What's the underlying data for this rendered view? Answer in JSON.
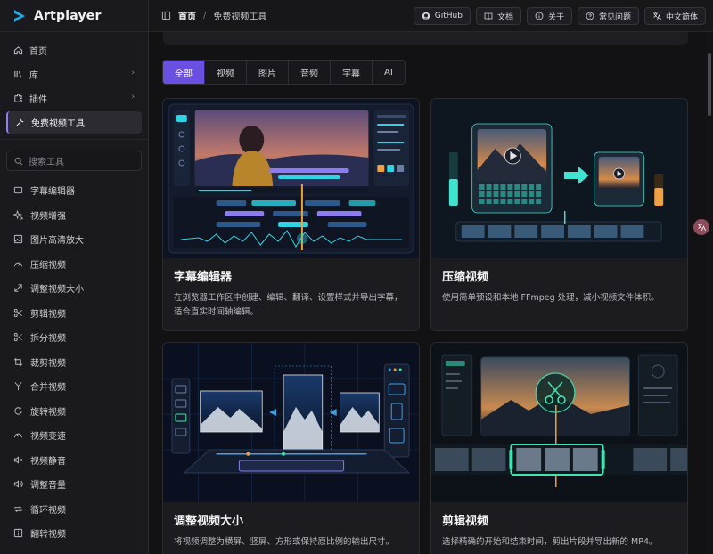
{
  "app": {
    "name": "Artplayer"
  },
  "sidebar": {
    "items": [
      {
        "label": "首页",
        "icon": "home-icon"
      },
      {
        "label": "库",
        "icon": "library-icon",
        "chevron": "›"
      },
      {
        "label": "插件",
        "icon": "puzzle-icon",
        "chevron": "›"
      },
      {
        "label": "免费视频工具",
        "icon": "wrench-icon"
      }
    ],
    "search_placeholder": "搜索工具",
    "tools": [
      {
        "label": "字幕编辑器",
        "icon": "subtitle-icon"
      },
      {
        "label": "视频增强",
        "icon": "sparkle-icon"
      },
      {
        "label": "图片高清放大",
        "icon": "image-icon"
      },
      {
        "label": "压缩视频",
        "icon": "gauge-icon"
      },
      {
        "label": "调整视频大小",
        "icon": "resize-icon"
      },
      {
        "label": "剪辑视频",
        "icon": "scissors-icon"
      },
      {
        "label": "拆分视频",
        "icon": "split-icon"
      },
      {
        "label": "裁剪视频",
        "icon": "crop-icon"
      },
      {
        "label": "合并视频",
        "icon": "merge-icon"
      },
      {
        "label": "旋转视频",
        "icon": "rotate-icon"
      },
      {
        "label": "视频变速",
        "icon": "speed-icon"
      },
      {
        "label": "视频静音",
        "icon": "mute-icon"
      },
      {
        "label": "调整音量",
        "icon": "volume-icon"
      },
      {
        "label": "循环视频",
        "icon": "loop-icon"
      },
      {
        "label": "翻转视频",
        "icon": "flip-icon"
      }
    ]
  },
  "header": {
    "breadcrumb_home": "首页",
    "breadcrumb_sep": "/",
    "breadcrumb_current": "免费视频工具",
    "buttons": [
      {
        "label": "GitHub",
        "icon": "github-icon"
      },
      {
        "label": "文档",
        "icon": "book-icon"
      },
      {
        "label": "关于",
        "icon": "info-icon"
      },
      {
        "label": "常见问题",
        "icon": "help-icon"
      },
      {
        "label": "中文简体",
        "icon": "translate-icon"
      }
    ]
  },
  "filters": [
    "全部",
    "视频",
    "图片",
    "音频",
    "字幕",
    "AI"
  ],
  "cards": [
    {
      "title": "字幕编辑器",
      "desc": "在浏览器工作区中创建、编辑、翻译、设置样式并导出字幕，适合直实时间轴编辑。"
    },
    {
      "title": "压缩视频",
      "desc": "使用简单预设和本地 FFmpeg 处理，减小视频文件体积。"
    },
    {
      "title": "调整视频大小",
      "desc": "将视频调整为横屏、竖屏、方形或保持原比例的输出尺寸。"
    },
    {
      "title": "剪辑视频",
      "desc": "选择精确的开始和结束时间，剪出片段并导出新的 MP4。"
    }
  ],
  "colors": {
    "accent": "#6a4fe0",
    "active_border": "#8f7cf7",
    "teal": "#3fe3d0"
  }
}
